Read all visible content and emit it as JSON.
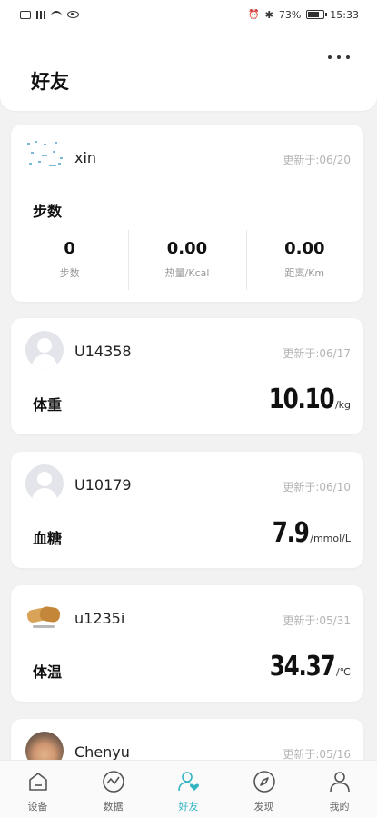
{
  "status_bar": {
    "battery": "73%",
    "time": "15:33",
    "battery_level": 0.73
  },
  "header": {
    "title": "好友"
  },
  "cards": [
    {
      "name": "xin",
      "updated": "更新于:06/20",
      "metric_label": "步数",
      "stats": [
        {
          "value": "0",
          "label": "步数"
        },
        {
          "value": "0.00",
          "label": "热量/Kcal"
        },
        {
          "value": "0.00",
          "label": "距离/Km"
        }
      ]
    },
    {
      "name": "U14358",
      "updated": "更新于:06/17",
      "metric_label": "体重",
      "value": "10.10",
      "unit": "/kg"
    },
    {
      "name": "U10179",
      "updated": "更新于:06/10",
      "metric_label": "血糖",
      "value": "7.9",
      "unit": "/mmol/L"
    },
    {
      "name": "u1235i",
      "updated": "更新于:05/31",
      "metric_label": "体温",
      "value": "34.37",
      "unit": "/℃"
    },
    {
      "name": "Chenyu",
      "updated": "更新于:05/16"
    }
  ],
  "nav": [
    {
      "label": "设备",
      "icon": "home-icon"
    },
    {
      "label": "数据",
      "icon": "chart-icon"
    },
    {
      "label": "好友",
      "icon": "friends-heart-icon",
      "active": true
    },
    {
      "label": "发现",
      "icon": "compass-icon"
    },
    {
      "label": "我的",
      "icon": "person-icon"
    }
  ],
  "colors": {
    "accent": "#35b4c4",
    "background": "#f2f2f2",
    "muted_text": "#b4b4b4"
  }
}
